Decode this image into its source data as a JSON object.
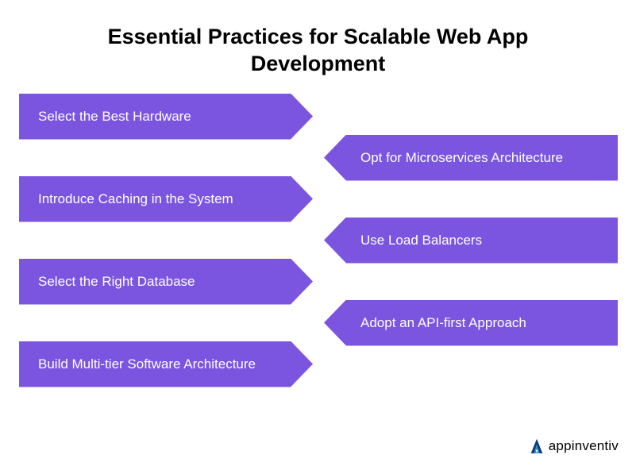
{
  "title": "Essential Practices for Scalable Web App Development",
  "practices": {
    "left": [
      "Select the Best Hardware",
      "Introduce Caching in the System",
      "Select the Right Database",
      "Build Multi-tier Software Architecture"
    ],
    "right": [
      "Opt for Microservices Architecture",
      "Use Load Balancers",
      "Adopt an API-first Approach"
    ]
  },
  "brand": {
    "name": "appinventiv",
    "accent_primary": "#0b3a78",
    "accent_secondary": "#2f87d0"
  },
  "colors": {
    "arrow_bg": "#7b55e0",
    "arrow_text": "#ffffff",
    "title_text": "#000000"
  }
}
